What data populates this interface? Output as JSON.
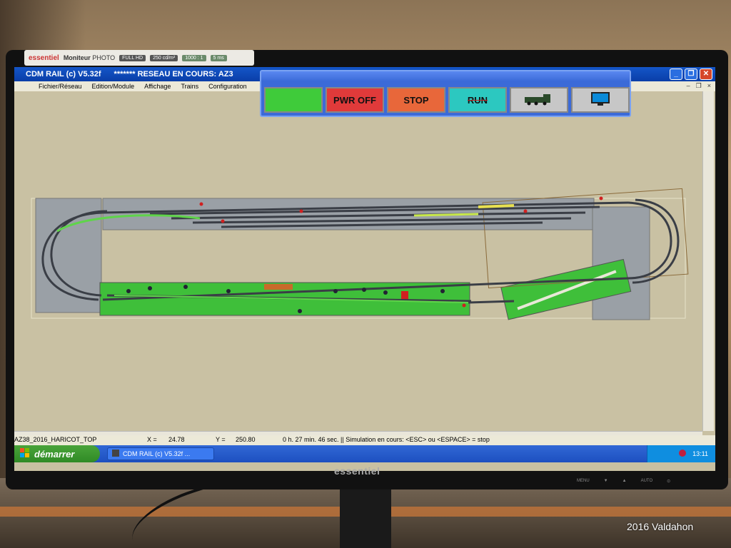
{
  "photo_watermark": "2016 Valdahon",
  "monitor": {
    "sticker": {
      "brand": "essentiel",
      "model": "Moniteur",
      "sub": "PHOTO",
      "items": [
        "FULL HD",
        "250 cd/m²",
        "1000 : 1",
        "5 ms"
      ]
    },
    "bezel_brand": "essentiel",
    "bezel_buttons": [
      "MENU",
      "▼",
      "▲",
      "AUTO",
      "⊙"
    ]
  },
  "window": {
    "title": "CDM RAIL (c) V5.32f",
    "reseau_label": "******* RESEAU EN COURS: AZ3",
    "controls": [
      "_",
      "❐",
      "✕"
    ]
  },
  "menu": {
    "items": [
      "Fichier/Réseau",
      "Edition/Module",
      "Affichage",
      "Trains",
      "Configuration"
    ],
    "mdi_controls": [
      "–",
      "❐",
      "×"
    ]
  },
  "toolbar": {
    "green": "",
    "pwr_off": "PWR OFF",
    "stop": "STOP",
    "run": "RUN"
  },
  "status": {
    "network": "AZ38_2016_HARICOT_TOP",
    "x_label": "X =",
    "x_value": "24.78",
    "y_label": "Y =",
    "y_value": "250.80",
    "message": "0 h. 27 min. 46 sec. || Simulation en cours: <ESC> ou <ESPACE> = stop"
  },
  "taskbar": {
    "start": "démarrer",
    "task": "CDM RAIL (c) V5.32f ...",
    "clock": "13:11"
  },
  "colors": {
    "titlebar": "#0a3ea8",
    "canvas": "#c9c1a3",
    "track": "#3a3e46",
    "scenery": "#3fbf3a",
    "module": "#9aa0a6"
  }
}
